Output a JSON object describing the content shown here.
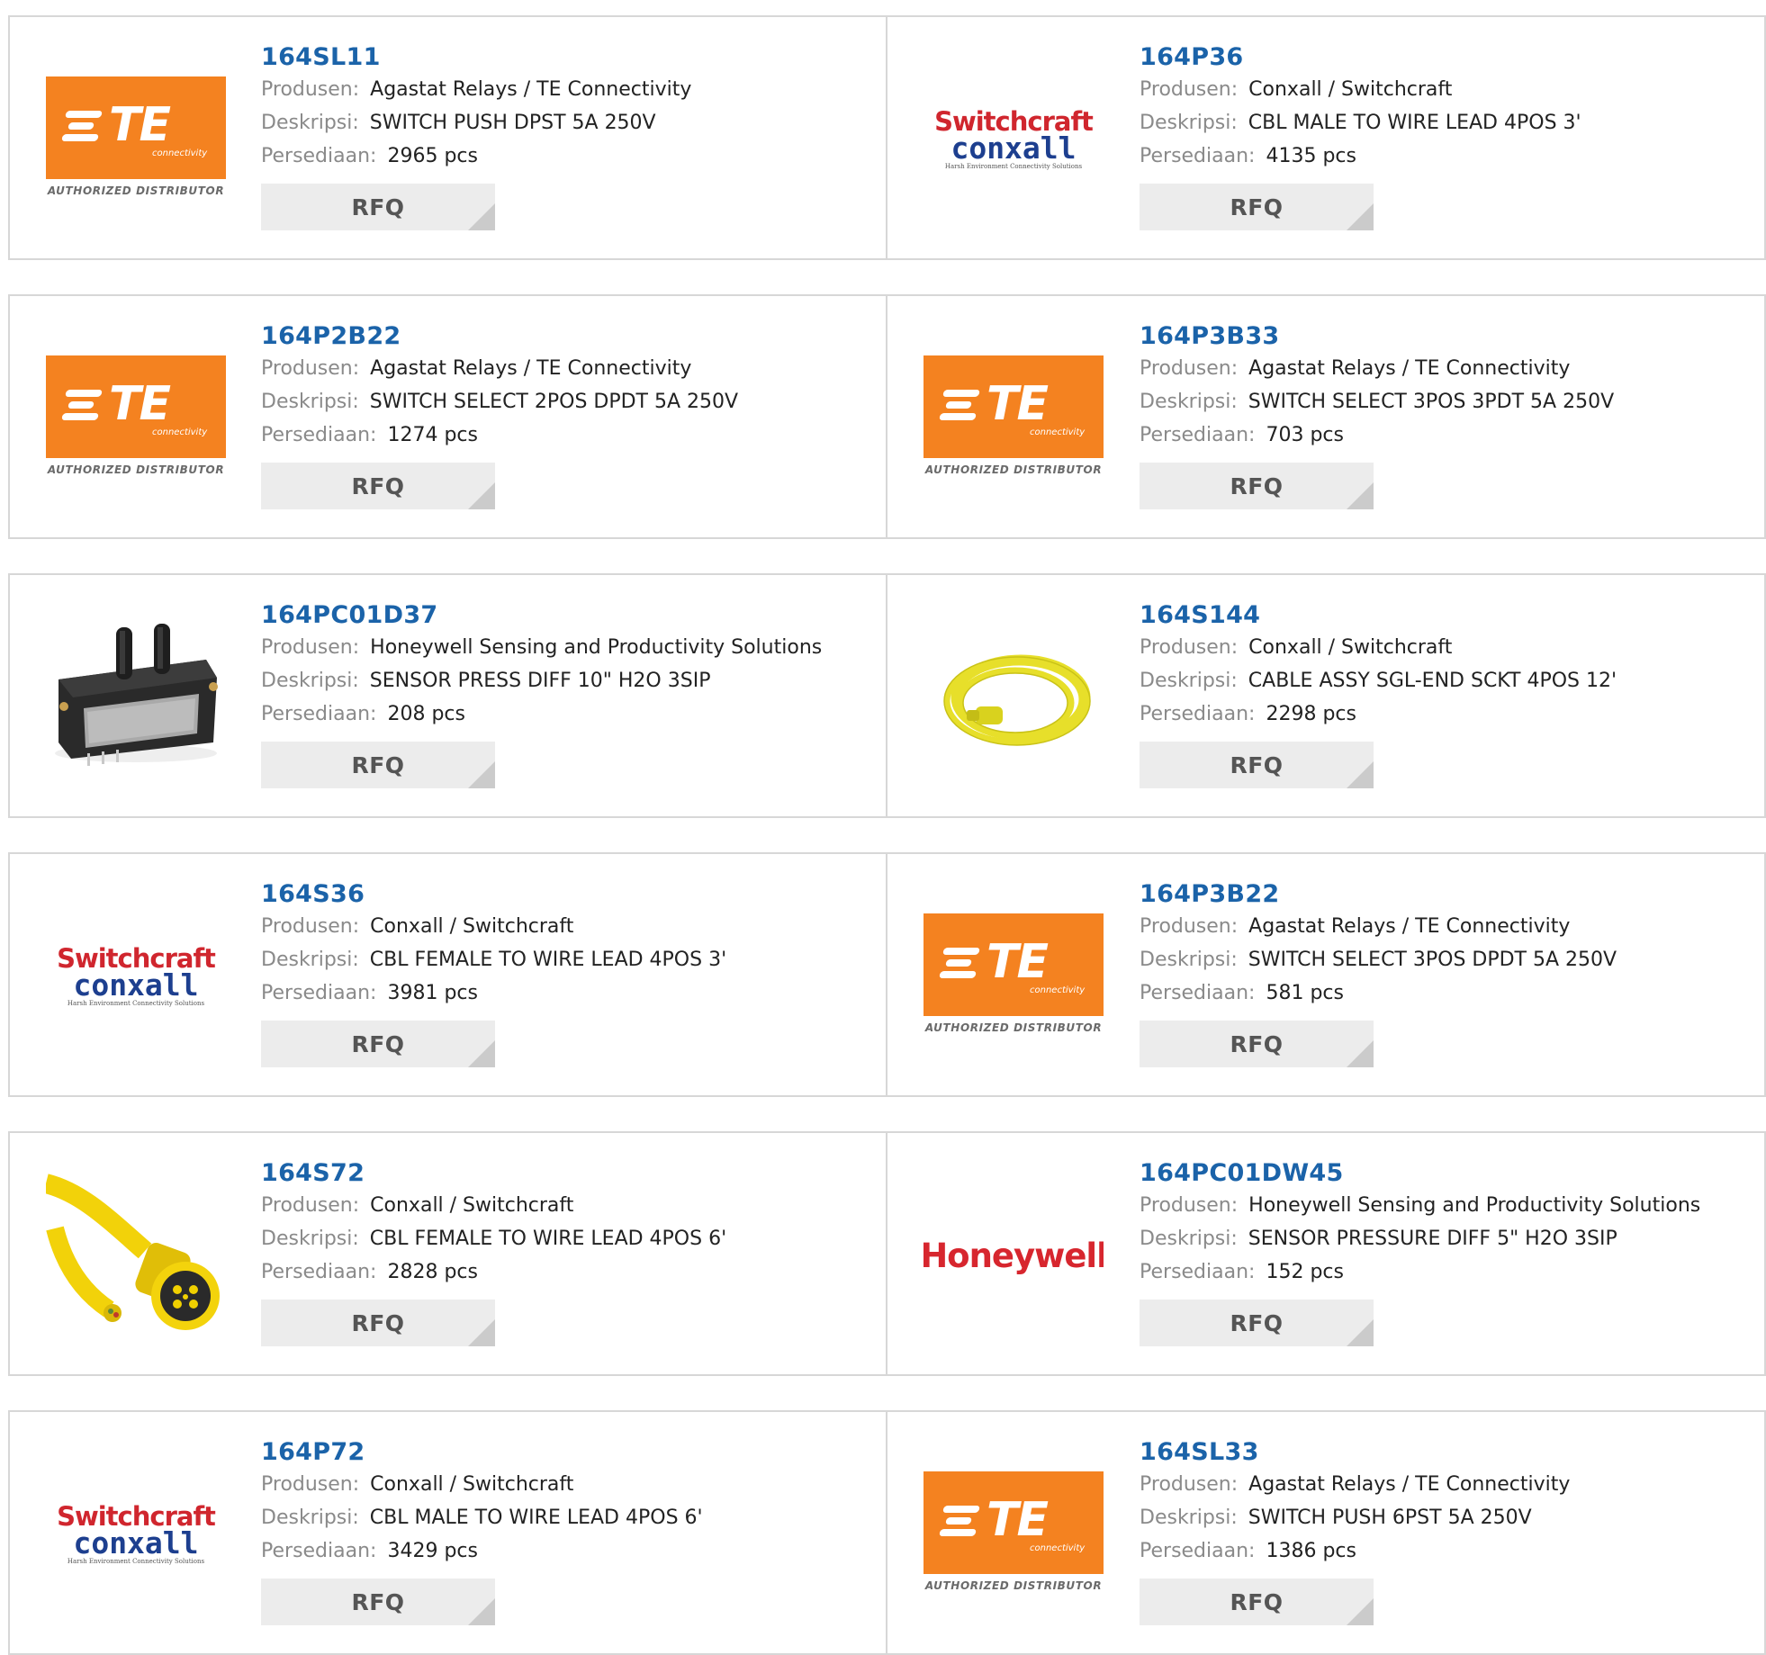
{
  "labels": {
    "manufacturer": "Produsen:",
    "description": "Deskripsi:",
    "stock": "Persediaan:",
    "rfq": "RFQ"
  },
  "logo_text": {
    "te_letters": "TE",
    "te_sub": "connectivity",
    "te_authorized": "AUTHORIZED DISTRIBUTOR",
    "switchcraft": "Switchcraft",
    "conxall": "conxall",
    "conxall_tagline": "Harsh Environment Connectivity Solutions",
    "honeywell": "Honeywell"
  },
  "colors": {
    "part_number_link": "#1b63a9",
    "te_orange": "#f48220",
    "switchcraft_red": "#d0262e",
    "conxall_blue": "#1d3f8f",
    "honeywell_red": "#d7262e",
    "rfq_bg": "#ececec",
    "card_border": "#d7d7d7"
  },
  "products": [
    {
      "part": "164SL11",
      "manufacturer": "Agastat Relays / TE Connectivity",
      "description": "SWITCH PUSH DPST 5A 250V",
      "stock": "2965 pcs",
      "image": "te-logo"
    },
    {
      "part": "164P36",
      "manufacturer": "Conxall / Switchcraft",
      "description": "CBL MALE TO WIRE LEAD 4POS 3'",
      "stock": "4135 pcs",
      "image": "switchcraft-conxall-logo"
    },
    {
      "part": "164P2B22",
      "manufacturer": "Agastat Relays / TE Connectivity",
      "description": "SWITCH SELECT 2POS DPDT 5A 250V",
      "stock": "1274 pcs",
      "image": "te-logo"
    },
    {
      "part": "164P3B33",
      "manufacturer": "Agastat Relays / TE Connectivity",
      "description": "SWITCH SELECT 3POS 3PDT 5A 250V",
      "stock": "703 pcs",
      "image": "te-logo"
    },
    {
      "part": "164PC01D37",
      "manufacturer": "Honeywell Sensing and Productivity Solutions",
      "description": "SENSOR PRESS DIFF 10\" H2O 3SIP",
      "stock": "208 pcs",
      "image": "pressure-sensor-photo"
    },
    {
      "part": "164S144",
      "manufacturer": "Conxall / Switchcraft",
      "description": "CABLE ASSY SGL-END SCKT 4POS 12'",
      "stock": "2298 pcs",
      "image": "yellow-cable-coil-photo"
    },
    {
      "part": "164S36",
      "manufacturer": "Conxall / Switchcraft",
      "description": "CBL FEMALE TO WIRE LEAD 4POS 3'",
      "stock": "3981 pcs",
      "image": "switchcraft-conxall-logo"
    },
    {
      "part": "164P3B22",
      "manufacturer": "Agastat Relays / TE Connectivity",
      "description": "SWITCH SELECT 3POS DPDT 5A 250V",
      "stock": "581 pcs",
      "image": "te-logo"
    },
    {
      "part": "164S72",
      "manufacturer": "Conxall / Switchcraft",
      "description": "CBL FEMALE TO WIRE LEAD 4POS 6'",
      "stock": "2828 pcs",
      "image": "yellow-connector-photo"
    },
    {
      "part": "164PC01DW45",
      "manufacturer": "Honeywell Sensing and Productivity Solutions",
      "description": "SENSOR PRESSURE DIFF 5\" H2O 3SIP",
      "stock": "152 pcs",
      "image": "honeywell-logo"
    },
    {
      "part": "164P72",
      "manufacturer": "Conxall / Switchcraft",
      "description": "CBL MALE TO WIRE LEAD 4POS 6'",
      "stock": "3429 pcs",
      "image": "switchcraft-conxall-logo"
    },
    {
      "part": "164SL33",
      "manufacturer": "Agastat Relays / TE Connectivity",
      "description": "SWITCH PUSH 6PST 5A 250V",
      "stock": "1386 pcs",
      "image": "te-logo"
    }
  ]
}
